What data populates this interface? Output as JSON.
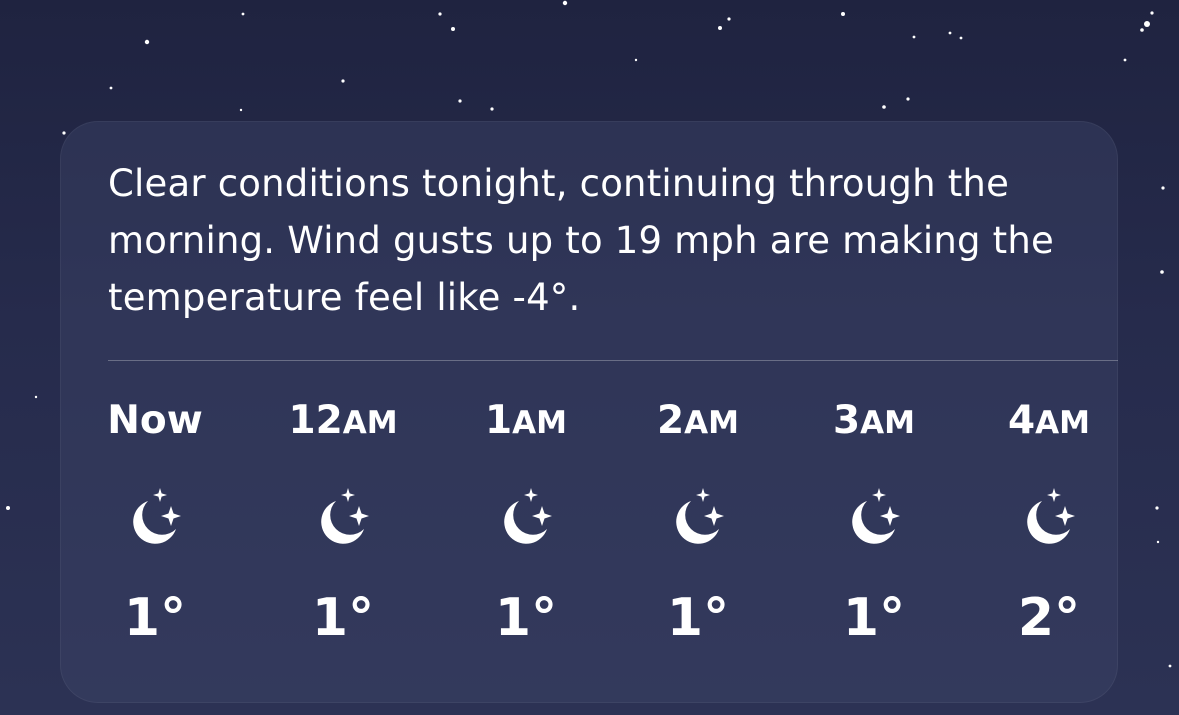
{
  "summary": {
    "text": "Clear conditions tonight, continuing through the morning. Wind gusts up to 19 mph are making the temperature feel like -4°."
  },
  "hourly": [
    {
      "time": "Now",
      "ampm": "",
      "icon": "moon-stars-icon",
      "temp": "1°"
    },
    {
      "time": "12",
      "ampm": "AM",
      "icon": "moon-stars-icon",
      "temp": "1°"
    },
    {
      "time": "1",
      "ampm": "AM",
      "icon": "moon-stars-icon",
      "temp": "1°"
    },
    {
      "time": "2",
      "ampm": "AM",
      "icon": "moon-stars-icon",
      "temp": "1°"
    },
    {
      "time": "3",
      "ampm": "AM",
      "icon": "moon-stars-icon",
      "temp": "1°"
    },
    {
      "time": "4",
      "ampm": "AM",
      "icon": "moon-stars-icon",
      "temp": "2°"
    }
  ],
  "colors": {
    "background_top": "#1f2340",
    "background_bottom": "#2c3254",
    "text": "#ffffff"
  }
}
